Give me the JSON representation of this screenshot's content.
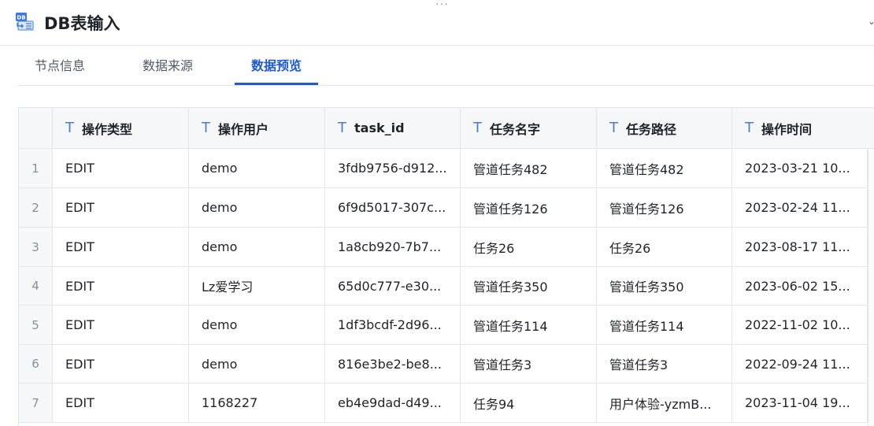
{
  "window": {
    "title": "DB表输入"
  },
  "tabs": [
    {
      "label": "节点信息"
    },
    {
      "label": "数据来源"
    },
    {
      "label": "数据预览"
    }
  ],
  "active_tab": "数据预览",
  "table": {
    "columns": [
      {
        "label": "操作类型",
        "icon": "text-type-icon"
      },
      {
        "label": "操作用户",
        "icon": "text-type-icon"
      },
      {
        "label": "task_id",
        "icon": "text-type-icon"
      },
      {
        "label": "任务名字",
        "icon": "text-type-icon"
      },
      {
        "label": "任务路径",
        "icon": "text-type-icon"
      },
      {
        "label": "操作时间",
        "icon": "text-type-icon"
      }
    ],
    "rows": [
      {
        "index": "1",
        "cells": [
          "EDIT",
          "demo",
          "3fdb9756-d912...",
          "管道任务482",
          "管道任务482",
          "2023-03-21 10..."
        ]
      },
      {
        "index": "2",
        "cells": [
          "EDIT",
          "demo",
          "6f9d5017-307c...",
          "管道任务126",
          "管道任务126",
          "2023-02-24 11..."
        ]
      },
      {
        "index": "3",
        "cells": [
          "EDIT",
          "demo",
          "1a8cb920-7b7...",
          "任务26",
          "任务26",
          "2023-08-17 11..."
        ]
      },
      {
        "index": "4",
        "cells": [
          "EDIT",
          "Lz爱学习",
          "65d0c777-e30...",
          "管道任务350",
          "管道任务350",
          "2023-06-02 15..."
        ]
      },
      {
        "index": "5",
        "cells": [
          "EDIT",
          "demo",
          "1df3bcdf-2d96...",
          "管道任务114",
          "管道任务114",
          "2022-11-02 10..."
        ]
      },
      {
        "index": "6",
        "cells": [
          "EDIT",
          "demo",
          "816e3be2-be8...",
          "管道任务3",
          "管道任务3",
          "2022-09-24 11..."
        ]
      },
      {
        "index": "7",
        "cells": [
          "EDIT",
          "1168227",
          "eb4e9dad-d49...",
          "任务94",
          "用户体验-yzmB...",
          "2023-11-04 19..."
        ]
      }
    ]
  },
  "colors": {
    "accent": "#1e59d6",
    "border": "#e5e6eb",
    "header_bg": "#f6f7f9"
  }
}
